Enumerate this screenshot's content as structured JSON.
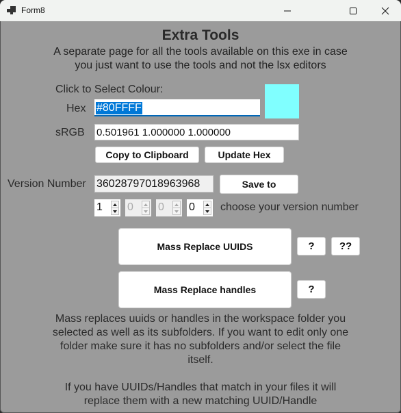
{
  "window": {
    "title": "Form8",
    "controls": {
      "minimize": "minimize",
      "maximize": "maximize",
      "close": "close"
    }
  },
  "header": {
    "title": "Extra Tools",
    "subtitle_lines": [
      "A separate page for all the tools available on this exe in case",
      "you just want to use the tools and not the lsx editors"
    ]
  },
  "colour": {
    "section_label": "Click to Select Colour:",
    "hex_label": "Hex",
    "hex_value": "#80FFFF",
    "srgb_label": "sRGB",
    "srgb_value": "0.501961 1.000000 1.000000",
    "swatch_color": "#80FFFF",
    "copy_button": "Copy to Clipboard",
    "update_button": "Update Hex"
  },
  "version": {
    "label": "Version Number",
    "value": "36028797018963968",
    "save_button": "Save to",
    "spinners": [
      {
        "value": "1",
        "enabled": true
      },
      {
        "value": "0",
        "enabled": false
      },
      {
        "value": "0",
        "enabled": false
      },
      {
        "value": "0",
        "enabled": true
      }
    ],
    "hint": "choose your version number"
  },
  "mass_replace": {
    "uuids_button": "Mass Replace UUIDS",
    "uuids_help": "?",
    "uuids_help2": "??",
    "handles_button": "Mass Replace handles",
    "handles_help": "?"
  },
  "description": {
    "lines": [
      "Mass replaces uuids or handles in the workspace folder you",
      "selected as well as its subfolders. If you want to edit only one",
      "folder make sure it has no subfolders and/or select the file",
      "itself.",
      "",
      "If you have UUIDs/Handles that match in your files it will",
      "replace them with a new matching UUID/Handle"
    ]
  },
  "colors": {
    "form_background": "#9B9B9B",
    "titlebar": "#F1F3F1",
    "selection": "#0078D7"
  }
}
